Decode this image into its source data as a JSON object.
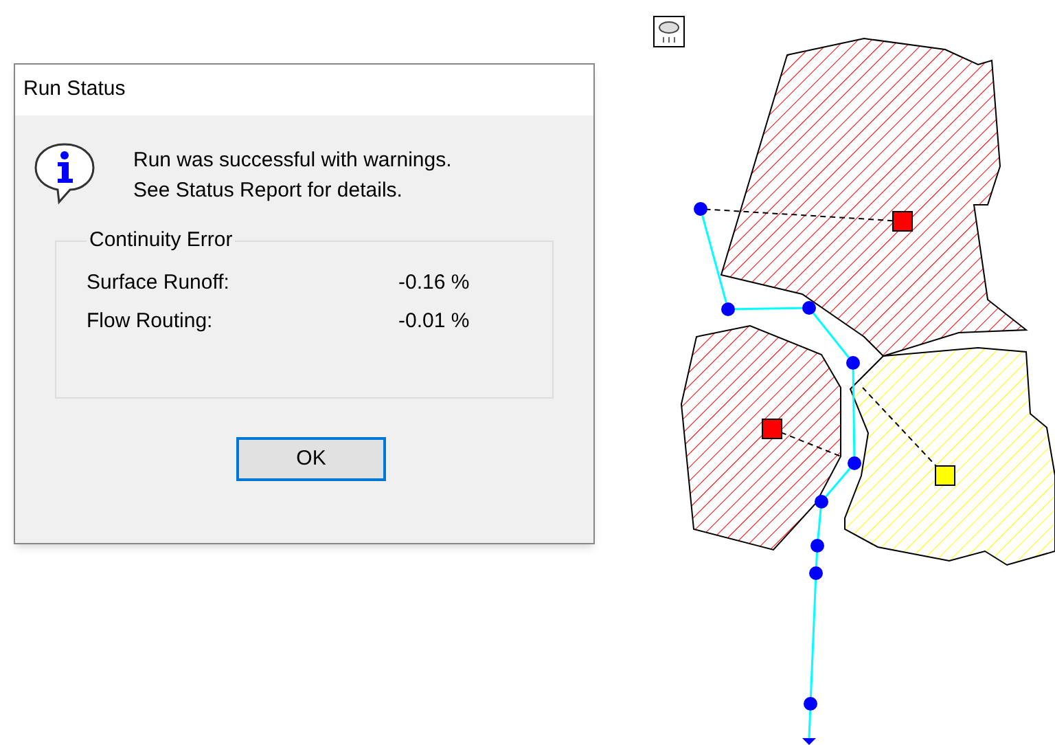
{
  "dialog": {
    "title": "Run Status",
    "message": [
      "Run was successful with warnings.",
      "See Status Report for details."
    ],
    "group": {
      "title": "Continuity Error",
      "rows": [
        {
          "label": "Surface Runoff:",
          "value": "-0.16 %"
        },
        {
          "label": "Flow Routing:",
          "value": "-0.01 %"
        }
      ]
    },
    "button": "OK"
  },
  "map": {
    "subcatchments": [
      {
        "color": "#ff0000"
      },
      {
        "color": "#ff0000"
      },
      {
        "color": "#ffff00"
      }
    ]
  }
}
